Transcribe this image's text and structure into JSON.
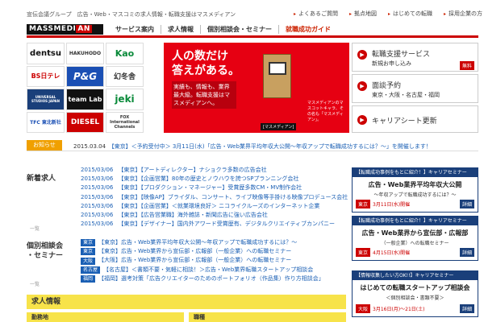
{
  "header": {
    "tagline": "宣伝会議グループ　広告・Web・マスコミの求人情報・転職支援はマスメディアン",
    "utility_links": [
      "よくあるご質問",
      "拠点地図",
      "はじめての転職",
      "採用企業の方"
    ]
  },
  "logo": {
    "text_main": "MASSMEDI",
    "text_accent": "AN"
  },
  "nav": {
    "items": [
      "サービス案内",
      "求人情報",
      "個別相談会・セミナー",
      "就職成功ガイド"
    ]
  },
  "client_logos": [
    "dentsu",
    "HAKUHODO",
    "Kao",
    "BS日テレ",
    "P&G",
    "幻冬舎",
    "UNIVERSAL STUDIOS JAPAN",
    "team Lab",
    "jeki",
    "TFC 東北新社",
    "DIESEL",
    "FOX International Channels"
  ],
  "hero": {
    "headline_line1": "人の数だけ",
    "headline_line2": "答えがある。",
    "body": "実績も、情報も、業界最大級。転職支援はマスメディアンへ。",
    "caption": "マスメディアンのマスコットキャラ、その名も「マスメディアン」。",
    "character_label": "[マスメディアン]"
  },
  "services": {
    "s1_title": "転職支援サービス",
    "s1_sub": "新規お申し込み",
    "s1_badge": "無料",
    "s2_title": "面談予約",
    "s2_sub": "東京・大阪・名古屋・福岡",
    "s3_title": "キャリアシート更新"
  },
  "notice": {
    "label": "お知らせ",
    "date": "2015.03.04",
    "text": "【東京】＜予約受付中＞ 3月11日(水)「広告・Web業界平均年収大公開～年収アップで転職成功するには？～」を開催します！"
  },
  "new_jobs": {
    "heading": "新着求人",
    "more": "一覧",
    "rows": [
      {
        "date": "2015/03/06",
        "text": "【東京】【アートディレクター】ナショクラ多数の広告会社"
      },
      {
        "date": "2015/03/06",
        "text": "【東京】【企画営業】80年の歴史とノウハウを誇つSPプランニング会社"
      },
      {
        "date": "2015/03/06",
        "text": "【東京】【プロダクション・マネージャー】受賞歴多数CM・MV制作会社"
      },
      {
        "date": "2015/03/06",
        "text": "【東京】【映像AP】ブライダル、コンサート、ライブ映像等手掛ける映像プロデュース会社"
      },
      {
        "date": "2015/03/06",
        "text": "【東京】【企画営業】＜就業環境良好＞ ニコライクルーズのインターネット企業"
      },
      {
        "date": "2015/03/06",
        "text": "【東京】【広告営業職】海外雑誌・新聞広告に強い広告会社"
      },
      {
        "date": "2015/03/06",
        "text": "【東京】【デザイナー】国内外アワード受賞歴有、デジタルクリエイティブカンパニー"
      }
    ]
  },
  "seminar": {
    "heading_line1": "個別相談会",
    "heading_line2": "・セミナー",
    "more": "一覧",
    "rows": [
      {
        "city": "東京",
        "text": "【東京】広告・Web業界平均年収大公開～年収アップで転職成功するには？～"
      },
      {
        "city": "東京",
        "text": "【東京】広告・Web業界から宣伝部・広報部（一般企業）への転職セミナー"
      },
      {
        "city": "大阪",
        "text": "【大阪】広告・Web業界から宣伝部・広報部（一般企業）への転職セミナー"
      },
      {
        "city": "名古屋",
        "text": "【名古屋】＜書類不要・気軽に相談！＞広告・Web業界転職スタートアップ相談会"
      },
      {
        "city": "福岡",
        "text": "【福岡】選考対策「広告クリエイターのためのポートフォリオ（作品集）作り方相談会」"
      }
    ]
  },
  "jobs_section": {
    "heading": "求人情報",
    "tab1": "勤務地",
    "tab2": "職種"
  },
  "promos": [
    {
      "header": "【転職成功事例をもとに紹介！】キャリアセミナー",
      "title": "広告・Web業界平均年収大公開",
      "sub": "～年収アップで転職成功するには？～",
      "city": "東京",
      "date": "3月11日(水)開催",
      "details": "詳細"
    },
    {
      "header": "【転職成功事例をもとに紹介！】キャリアセミナー",
      "title": "広告・Web業界から宣伝部・広報部",
      "sub": "（一般企業）への転職セミナー",
      "city": "東京",
      "date": "4月15日(水)開催",
      "details": "詳細"
    },
    {
      "header": "【情報収集したい方OK!!】キャリアセミナー",
      "title": "はじめての転職スタートアップ相談会",
      "sub": "＜個別相談会・書類不要＞",
      "city": "大阪",
      "date": "3月16日(月)～21日(土)",
      "details": "詳細"
    }
  ]
}
